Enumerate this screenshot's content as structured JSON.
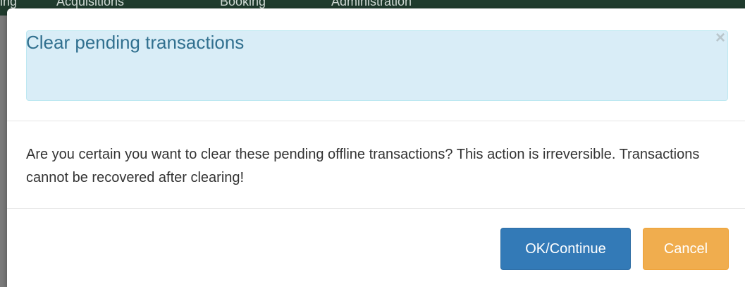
{
  "background": {
    "nav_items": [
      "ing",
      "Acquisitions",
      "Booking",
      "Administration"
    ]
  },
  "modal": {
    "title": "Clear pending transactions",
    "close_symbol": "×",
    "message": "Are you certain you want to clear these pending offline transactions? This action is irreversible. Transactions cannot be recovered after clearing!",
    "buttons": {
      "ok_label": "OK/Continue",
      "cancel_label": "Cancel"
    }
  },
  "colors": {
    "header_alert_bg": "#d9edf7",
    "title_text": "#31708f",
    "primary_button": "#337ab7",
    "warning_button": "#f0ad4e"
  }
}
